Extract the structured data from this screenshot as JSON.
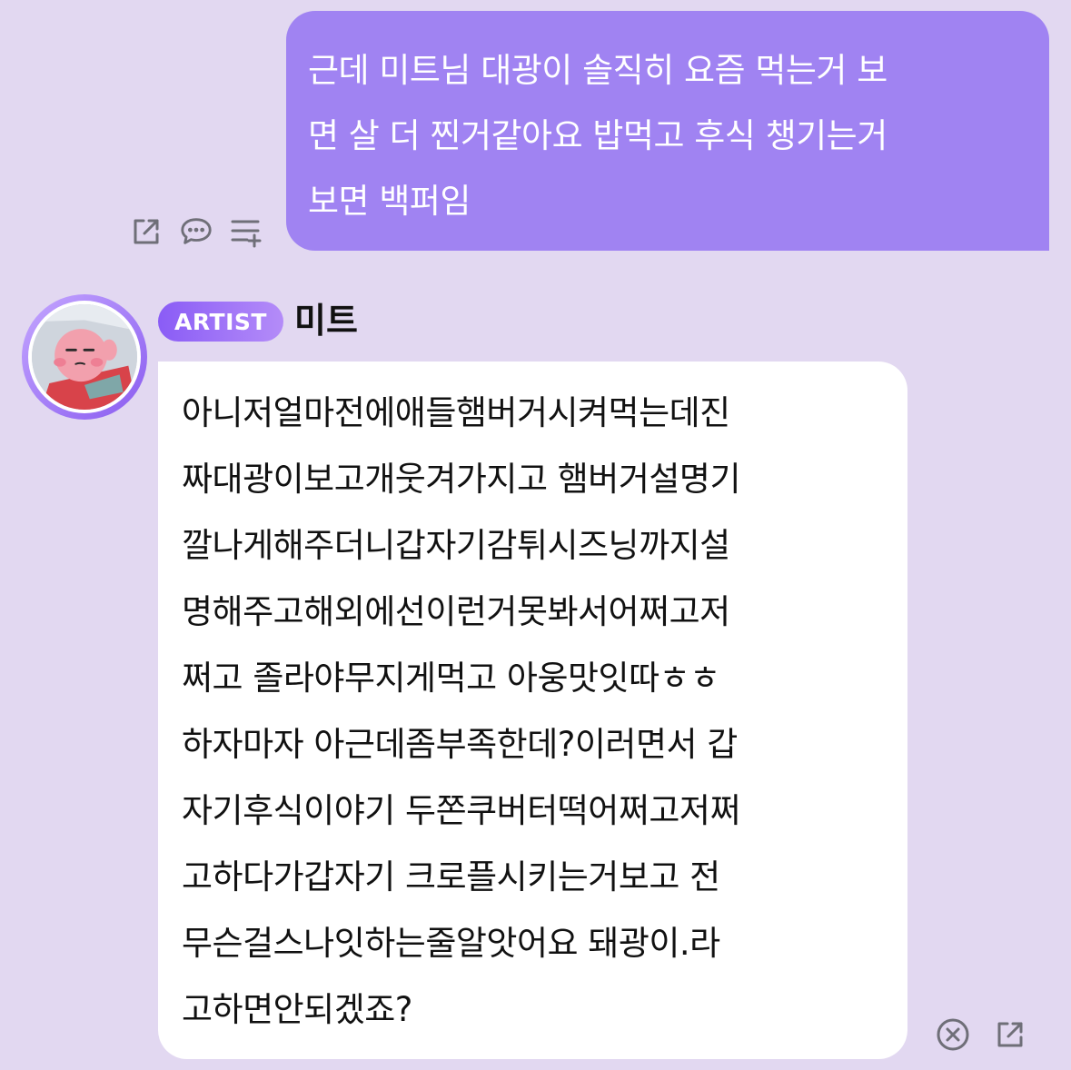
{
  "sent_message": {
    "lines": [
      "근데 미트님 대광이 솔직히 요즘 먹는거 보",
      "면 살 더 찐거같아요 밥먹고 후식 챙기는거",
      "보면 백퍼임"
    ],
    "actions": [
      "share-icon",
      "reply-icon",
      "add-list-icon"
    ]
  },
  "received_message": {
    "badge": "ARTIST",
    "sender": "미트",
    "lines": [
      "아니저얼마전에애들햄버거시켜먹는데진",
      "짜대광이보고개웃겨가지고 햄버거설명기",
      "깔나게해주더니갑자기감튀시즈닝까지설",
      "명해주고해외에선이런거못봐서어쩌고저",
      "쩌고 졸라야무지게먹고 아웅맛잇따ㅎㅎ",
      "하자마자 아근데좀부족한데?이러면서 갑",
      "자기후식이야기 두쫀쿠버터떡어쩌고저쩌",
      "고하다가갑자기 크로플시키는거보고 전",
      "무슨걸스나잇하는줄알앗어요 돼광이.라",
      "고하면안되겠죠?"
    ],
    "actions": [
      "close-circle-icon",
      "share-icon"
    ]
  },
  "colors": {
    "background": "#e2d8f1",
    "sent_bubble": "#a083f2",
    "received_bubble": "#ffffff",
    "badge_start": "#8a5cf6",
    "badge_end": "#b48cf8",
    "icon": "#6f6f78"
  }
}
